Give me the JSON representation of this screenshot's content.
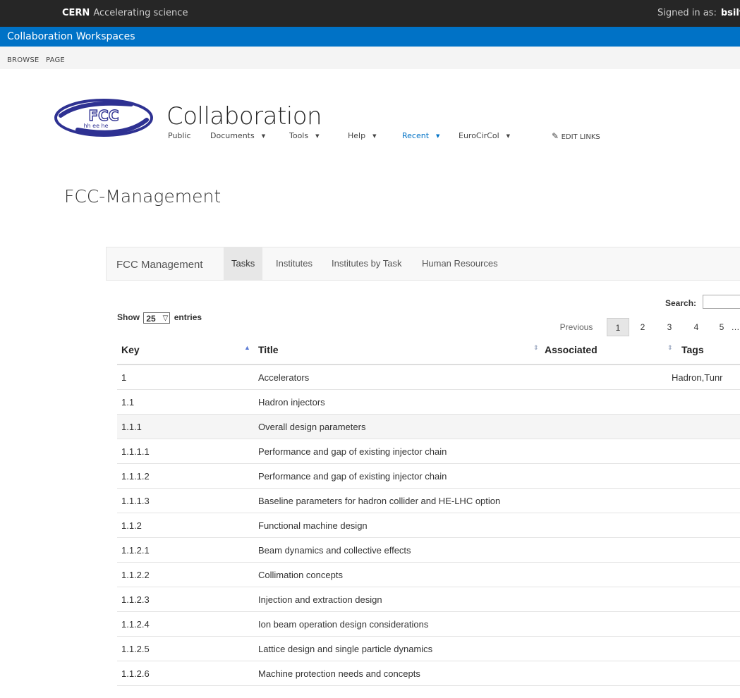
{
  "cern_bar": {
    "brand": "CERN",
    "tagline": "Accelerating science",
    "signed_in_label": "Signed in as:",
    "user": "bsilva"
  },
  "suite_bar": {
    "title": "Collaboration Workspaces"
  },
  "ribbon": {
    "tabs": [
      "BROWSE",
      "PAGE"
    ]
  },
  "site": {
    "logo_text": "FCC",
    "logo_subtext": "hh ee he",
    "title": "Collaboration",
    "nav": [
      {
        "label": "Public"
      },
      {
        "label": "Documents"
      },
      {
        "label": "Tools"
      },
      {
        "label": "Help"
      },
      {
        "label": "Recent"
      },
      {
        "label": "EuroCirCol"
      }
    ],
    "edit_links": "EDIT LINKS"
  },
  "page_title": "FCC-Management",
  "inner_nav": {
    "brand": "FCC Management",
    "tabs": [
      "Tasks",
      "Institutes",
      "Institutes by Task",
      "Human Resources"
    ],
    "active": "Tasks"
  },
  "controls": {
    "show_label": "Show",
    "entries_value": "25",
    "entries_label": "entries",
    "search_label": "Search:",
    "search_value": ""
  },
  "pagination": {
    "previous": "Previous",
    "pages": [
      "1",
      "2",
      "3",
      "4",
      "5",
      "…"
    ],
    "current": "1"
  },
  "table": {
    "headers": [
      "Key",
      "Title",
      "Associated",
      "Tags"
    ],
    "rows": [
      {
        "key": "1",
        "title": "Accelerators",
        "tags": "Hadron,Tunr"
      },
      {
        "key": "1.1",
        "title": "Hadron injectors",
        "tags": ""
      },
      {
        "key": "1.1.1",
        "title": "Overall design parameters",
        "tags": ""
      },
      {
        "key": "1.1.1.1",
        "title": "Performance and gap of existing injector chain",
        "tags": ""
      },
      {
        "key": "1.1.1.2",
        "title": "Performance and gap of existing injector chain",
        "tags": ""
      },
      {
        "key": "1.1.1.3",
        "title": "Baseline parameters for hadron collider and HE-LHC option",
        "tags": ""
      },
      {
        "key": "1.1.2",
        "title": "Functional machine design",
        "tags": ""
      },
      {
        "key": "1.1.2.1",
        "title": "Beam dynamics and collective effects",
        "tags": ""
      },
      {
        "key": "1.1.2.2",
        "title": "Collimation concepts",
        "tags": ""
      },
      {
        "key": "1.1.2.3",
        "title": "Injection and extraction design",
        "tags": ""
      },
      {
        "key": "1.1.2.4",
        "title": "Ion beam operation design considerations",
        "tags": ""
      },
      {
        "key": "1.1.2.5",
        "title": "Lattice design and single particle dynamics",
        "tags": ""
      },
      {
        "key": "1.1.2.6",
        "title": "Machine protection needs and concepts",
        "tags": ""
      }
    ]
  }
}
